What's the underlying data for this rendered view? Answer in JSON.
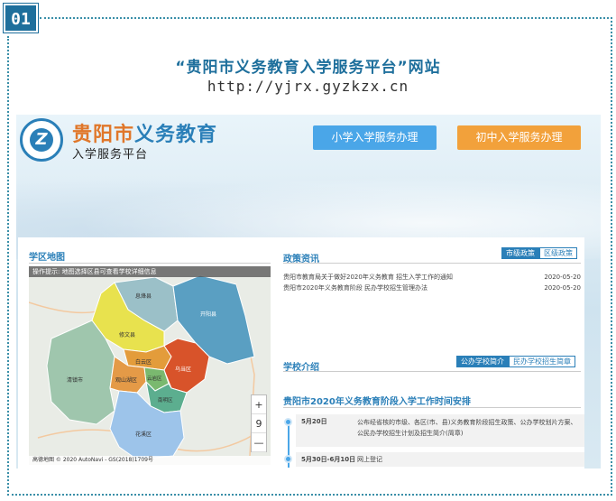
{
  "badge": "01",
  "heading": {
    "title": "“贵阳市义务教育入学服务平台”网站",
    "url": "http://yjrx.gyzkzx.cn"
  },
  "site": {
    "brand_prefix": "贵阳市",
    "brand_suffix": "义务教育",
    "brand_sub": "入学服务平台",
    "btn_primary": "小学入学服务办理",
    "btn_middle": "初中入学服务办理"
  },
  "map": {
    "heading": "学区地图",
    "hint": "操作提示: 地图选择区县可查看学校详细信息",
    "zoom_in": "+",
    "zoom_level": "9",
    "zoom_out": "—",
    "footer": "高德地图 © 2020 AutoNavi - GS(2018)1709号",
    "districts": [
      "息烽县",
      "开阳县",
      "修文县",
      "清镇市",
      "白云区",
      "乌当区",
      "观山湖区",
      "云岩区",
      "南明区",
      "花溪区"
    ],
    "colors": {
      "xifeng": "#9bc0c8",
      "kaiyang": "#5a9fc2",
      "xiuwen": "#e8e24e",
      "qingzhen": "#9fc6ad",
      "baiyun": "#e39c3b",
      "wudang": "#d8532a",
      "guanshanhu": "#e49a47",
      "yunyan": "#7ab96f",
      "nanming": "#5cae8f",
      "huaxi": "#9dc4ea"
    }
  },
  "policy": {
    "heading": "政策资讯",
    "tabs": [
      "市级政策",
      "区级政策"
    ],
    "items": [
      {
        "text": "贵阳市教育局关于做好2020年义务教育 招生入学工作的通知",
        "date": "2020-05-20"
      },
      {
        "text": "贵阳市2020年义务教育阶段 民办学校招生管理办法",
        "date": "2020-05-20"
      }
    ]
  },
  "schools": {
    "heading": "学校介绍",
    "tabs": [
      "公办学校简介",
      "民办学校招生简章"
    ]
  },
  "schedule": {
    "heading": "贵阳市2020年义务教育阶段入学工作时间安排",
    "items": [
      {
        "date": "5月20日",
        "text": "公布经省核的市级、各区(市、县)义务教育阶段招生政策、公办学校划片方案、公民办学校招生计划及招生简介(简章)"
      },
      {
        "date": "5月30日-6月10日",
        "text": "网上登记"
      }
    ]
  }
}
